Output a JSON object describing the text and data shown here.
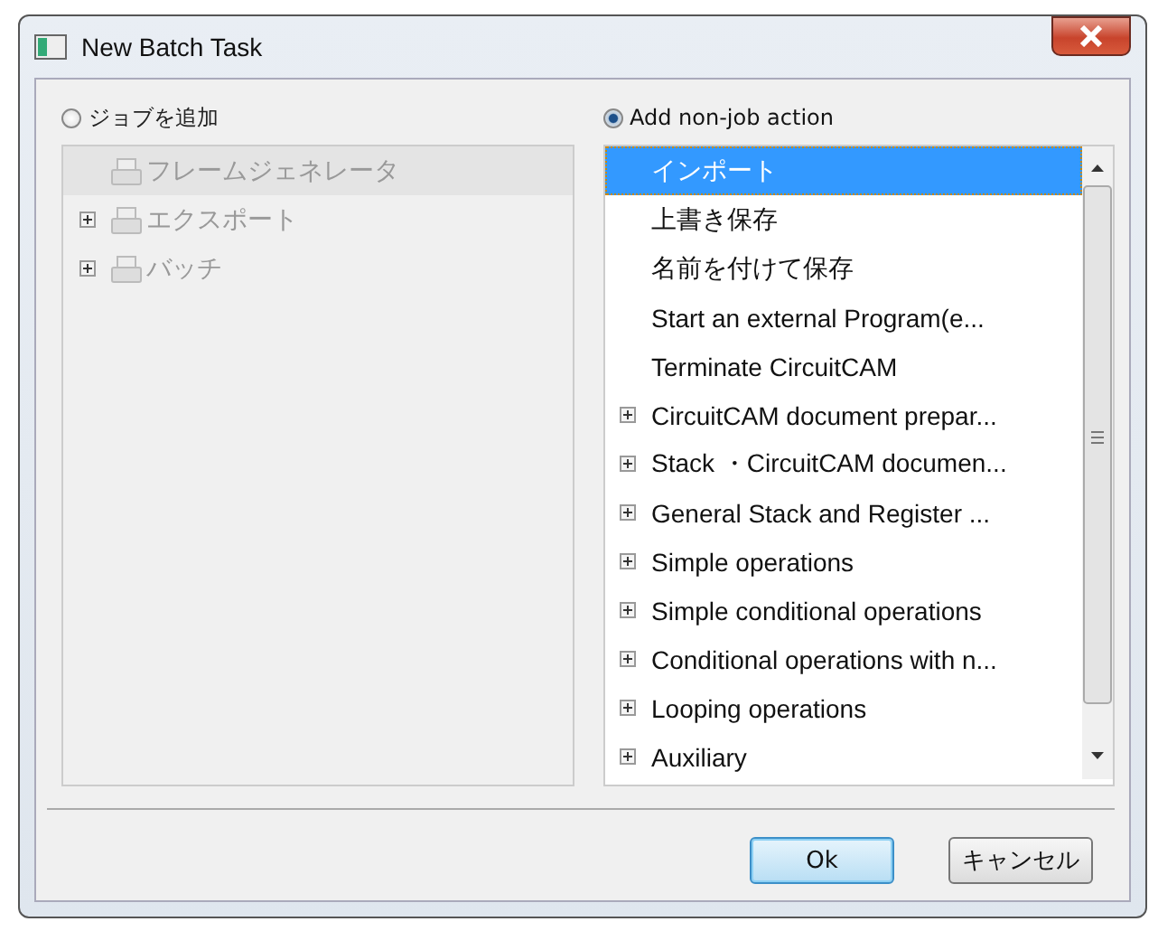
{
  "window": {
    "title": "New Batch Task"
  },
  "options": [
    {
      "label": "ジョブを追加",
      "selected": false,
      "disabled": true,
      "items": [
        {
          "label": "フレームジェネレータ",
          "kind": "action",
          "selected": true
        },
        {
          "label": "エクスポート",
          "kind": "group",
          "selected": false
        },
        {
          "label": "バッチ",
          "kind": "group",
          "selected": false
        }
      ]
    },
    {
      "label": "Add non-job action",
      "selected": true,
      "disabled": false,
      "items": [
        {
          "label": "インポート",
          "kind": "action",
          "selected": true
        },
        {
          "label": "上書き保存",
          "kind": "action",
          "selected": false
        },
        {
          "label": "名前を付けて保存",
          "kind": "action",
          "selected": false
        },
        {
          "label": "Start an external Program(e...",
          "kind": "action",
          "selected": false
        },
        {
          "label": "Terminate CircuitCAM",
          "kind": "action",
          "selected": false
        },
        {
          "label": "CircuitCAM document prepar...",
          "kind": "group",
          "selected": false
        },
        {
          "label": "Stack ・CircuitCAM documen...",
          "kind": "group",
          "selected": false
        },
        {
          "label": "General Stack and Register ...",
          "kind": "group",
          "selected": false
        },
        {
          "label": "Simple operations",
          "kind": "group",
          "selected": false
        },
        {
          "label": "Simple conditional operations",
          "kind": "group",
          "selected": false
        },
        {
          "label": "Conditional operations with n...",
          "kind": "group",
          "selected": false
        },
        {
          "label": "Looping operations",
          "kind": "group",
          "selected": false
        },
        {
          "label": "Auxiliary",
          "kind": "group",
          "selected": false
        }
      ]
    }
  ],
  "buttons": [
    {
      "label": "Ok",
      "kind": "default"
    },
    {
      "label": "キャンセル",
      "kind": "normal"
    }
  ]
}
